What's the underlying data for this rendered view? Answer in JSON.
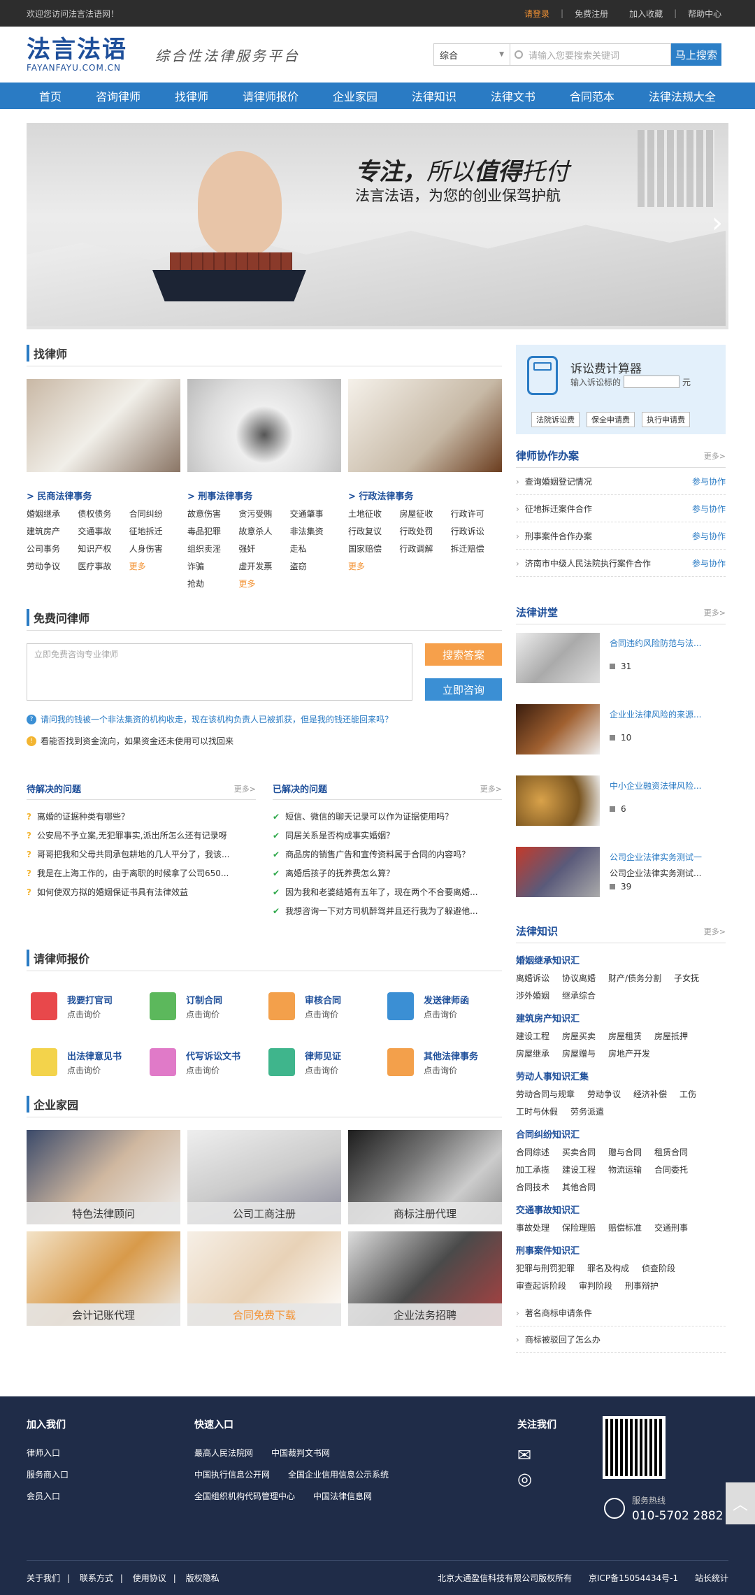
{
  "topbar": {
    "welcome": "欢迎您访问法言法语网！",
    "login": "请登录",
    "register": "免费注册",
    "favorite": "加入收藏",
    "help": "帮助中心"
  },
  "header": {
    "logo_cn": "法言法语",
    "logo_en": "FAYANFAYU.COM.CN",
    "slogan": "综合性法律服务平台",
    "select_value": "综合",
    "search_placeholder": "请输入您要搜索关键词",
    "search_button": "马上搜索"
  },
  "nav": [
    "首页",
    "咨询律师",
    "找律师",
    "请律师报价",
    "企业家园",
    "法律知识",
    "法律文书",
    "合同范本",
    "法律法规大全"
  ],
  "banner": {
    "headline_1": "专注，",
    "headline_2": "所以",
    "headline_3": "值得",
    "headline_4": "托付",
    "subline": "法言法语，为您的创业保驾护航"
  },
  "find_lawyer": {
    "title": "找律师",
    "columns": [
      {
        "heading": "> 民商法律事务",
        "items": [
          "婚姻继承",
          "债权债务",
          "合同纠纷",
          "建筑房产",
          "交通事故",
          "征地拆迁",
          "公司事务",
          "知识产权",
          "人身伤害",
          "劳动争议",
          "医疗事故",
          "更多"
        ]
      },
      {
        "heading": "> 刑事法律事务",
        "items": [
          "故意伤害",
          "贪污受贿",
          "交通肇事",
          "毒品犯罪",
          "故意杀人",
          "非法集资",
          "组织卖淫",
          "强奸",
          "走私",
          "诈骗",
          "虚开发票",
          "盗窃",
          "抢劫",
          "更多"
        ]
      },
      {
        "heading": "> 行政法律事务",
        "items": [
          "土地征收",
          "房屋征收",
          "行政许可",
          "行政复议",
          "行政处罚",
          "行政诉讼",
          "国家赔偿",
          "行政调解",
          "拆迁赔偿",
          "更多"
        ]
      }
    ]
  },
  "free_ask": {
    "title": "免费问律师",
    "placeholder": "立即免费咨询专业律师",
    "btn_search": "搜索答案",
    "btn_consult": "立即咨询",
    "q": "请问我的钱被一个非法集资的机构收走，现在该机构负责人已被抓获，但是我的钱还能回来吗？",
    "a": "看能否找到资金流向，如果资金还未使用可以找回来"
  },
  "pending": {
    "title": "待解决的问题",
    "more": "更多>",
    "items": [
      "离婚的证据种类有哪些？",
      "公安局不予立案,无犯罪事实,派出所怎么还有记录呀",
      "哥哥把我和父母共同承包耕地的几人平分了，我该...",
      "我是在上海工作的，由于离职的时候拿了公司650...",
      "如何使双方拟的婚姻保证书具有法律效益"
    ]
  },
  "solved": {
    "title": "已解决的问题",
    "more": "更多>",
    "items": [
      "短信、微信的聊天记录可以作为证据使用吗？",
      "同居关系是否构成事实婚姻？",
      "商品房的销售广告和宣传资料属于合同的内容吗？",
      "离婚后孩子的抚养费怎么算？",
      "因为我和老婆结婚有五年了，现在两个不合要离婚...",
      "我想咨询一下对方司机醉驾并且还行我为了躲避他..."
    ]
  },
  "price": {
    "title": "请律师报价",
    "items": [
      {
        "name": "我要打官司",
        "sub": "点击询价",
        "icon": "people-icon",
        "color": "#e8484b"
      },
      {
        "name": "订制合同",
        "sub": "点击询价",
        "icon": "clipboard-icon",
        "color": "#5cb85c"
      },
      {
        "name": "审核合同",
        "sub": "点击询价",
        "icon": "document-icon",
        "color": "#f3a04b"
      },
      {
        "name": "发送律师函",
        "sub": "点击询价",
        "icon": "printer-icon",
        "color": "#3b8fd4"
      },
      {
        "name": "出法律意见书",
        "sub": "点击询价",
        "icon": "note-icon",
        "color": "#f3d34b"
      },
      {
        "name": "代写诉讼文书",
        "sub": "点击询价",
        "icon": "pen-icon",
        "color": "#e07ac8"
      },
      {
        "name": "律师见证",
        "sub": "点击询价",
        "icon": "add-user-icon",
        "color": "#3fb58c"
      },
      {
        "name": "其他法律事务",
        "sub": "点击询价",
        "icon": "folder-icon",
        "color": "#f3a04b"
      }
    ]
  },
  "enterprise": {
    "title": "企业家园",
    "items": [
      "特色法律顾问",
      "公司工商注册",
      "商标注册代理",
      "会计记账代理",
      "合同免费下载",
      "企业法务招聘"
    ]
  },
  "calc": {
    "title": "诉讼费计算器",
    "label": "输入诉讼标的",
    "unit": "元",
    "buttons": [
      "法院诉讼费",
      "保全申请费",
      "执行申请费"
    ]
  },
  "cooperate": {
    "title": "律师协作办案",
    "more": "更多>",
    "items": [
      "查询婚姻登记情况",
      "征地拆迁案件合作",
      "刑事案件合作办案",
      "济南市中级人民法院执行案件合作"
    ],
    "action": "参与协作"
  },
  "lectures": {
    "title": "法律讲堂",
    "more": "更多>",
    "items": [
      {
        "title": "合同违约风险防范与法...",
        "sub": "",
        "count": "31"
      },
      {
        "title": "企业业法律风险的来源...",
        "sub": "",
        "count": "10"
      },
      {
        "title": "中小企业融资法律风险...",
        "sub": "",
        "count": "6"
      },
      {
        "title": "公司企业法律实务测试一",
        "sub": "公司企业法律实务测试...",
        "count": "39"
      }
    ]
  },
  "knowledge": {
    "title": "法律知识",
    "more": "更多>",
    "groups": [
      {
        "h": "婚姻继承知识汇",
        "items": [
          "离婚诉讼",
          "协议离婚",
          "财产/债务分割",
          "子女抚",
          "涉外婚姻",
          "继承综合"
        ]
      },
      {
        "h": "建筑房产知识汇",
        "items": [
          "建设工程",
          "房屋买卖",
          "房屋租赁",
          "房屋抵押",
          "房屋继承",
          "房屋赠与",
          "房地产开发"
        ]
      },
      {
        "h": "劳动人事知识汇集",
        "items": [
          "劳动合同与规章",
          "劳动争议",
          "经济补偿",
          "工伤",
          "工时与休假",
          "劳务派遣"
        ]
      },
      {
        "h": "合同纠纷知识汇",
        "items": [
          "合同综述",
          "买卖合同",
          "赠与合同",
          "租赁合同",
          "加工承揽",
          "建设工程",
          "物流运输",
          "合同委托",
          "合同技术",
          "其他合同"
        ]
      },
      {
        "h": "交通事故知识汇",
        "items": [
          "事故处理",
          "保险理赔",
          "赔偿标准",
          "交通刑事"
        ]
      },
      {
        "h": "刑事案件知识汇",
        "items": [
          "犯罪与刑罚犯罪",
          "罪名及构成",
          "侦查阶段",
          "审查起诉阶段",
          "审判阶段",
          "刑事辩护"
        ]
      }
    ],
    "extra": [
      "著名商标申请条件",
      "商标被驳回了怎么办"
    ]
  },
  "footer": {
    "join": {
      "h": "加入我们",
      "items": [
        "律师入口",
        "服务商入口",
        "会员入口"
      ]
    },
    "quick": {
      "h": "快速入口",
      "rows": [
        [
          "最高人民法院网",
          "中国裁判文书网"
        ],
        [
          "中国执行信息公开网",
          "全国企业信用信息公示系统"
        ],
        [
          "全国组织机构代码管理中心",
          "中国法律信息网"
        ]
      ]
    },
    "follow": "关注我们",
    "hotline_label": "服务热线",
    "hotline": "010-5702 2882",
    "bottom_links": [
      "关于我们",
      "联系方式",
      "使用协议",
      "版权隐私"
    ],
    "copyright": "北京大通盈信科技有限公司版权所有",
    "icp": "京ICP备15054434号-1",
    "stats": "站长统计"
  }
}
